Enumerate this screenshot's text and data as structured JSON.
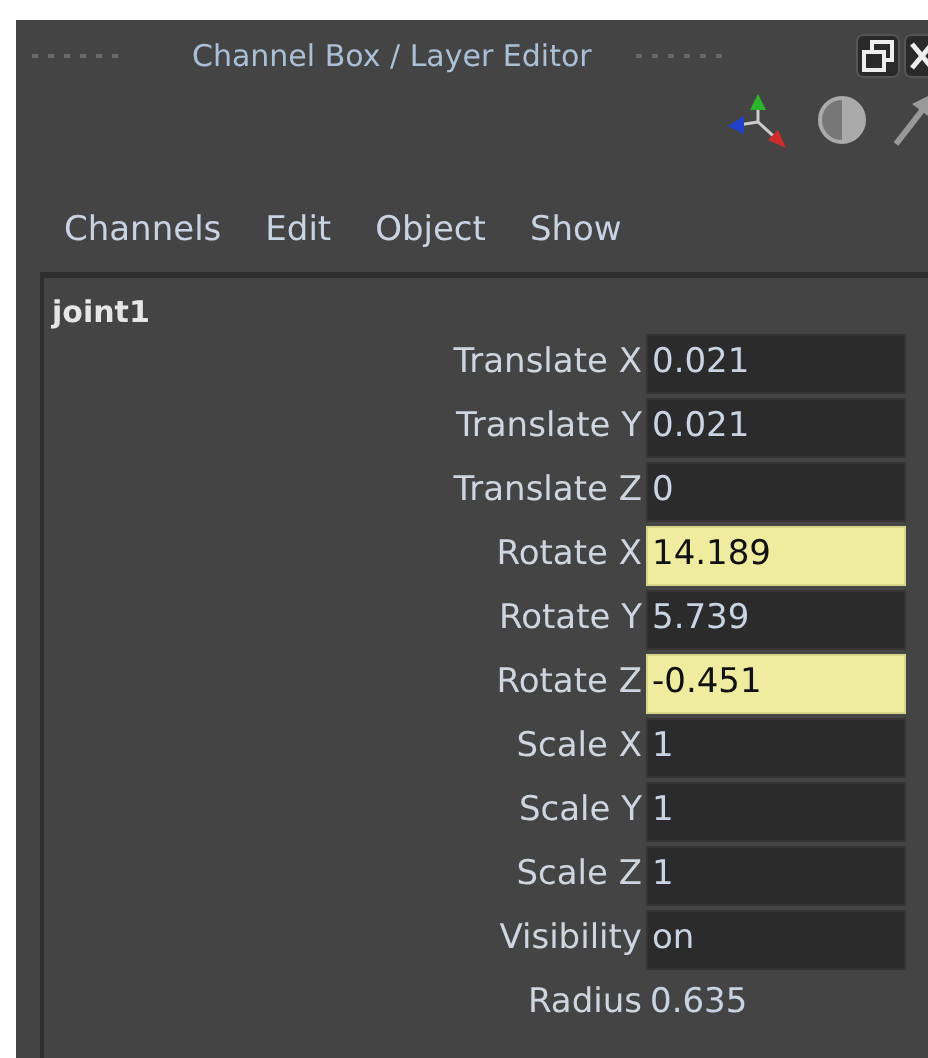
{
  "window": {
    "title": "Channel Box / Layer Editor"
  },
  "menu": [
    "Channels",
    "Edit",
    "Object",
    "Show"
  ],
  "node": {
    "name": "joint1"
  },
  "channels": [
    {
      "label": "Translate X",
      "value": "0.021",
      "kind": "field",
      "keyed": false
    },
    {
      "label": "Translate Y",
      "value": "0.021",
      "kind": "field",
      "keyed": false
    },
    {
      "label": "Translate Z",
      "value": "0",
      "kind": "field",
      "keyed": false
    },
    {
      "label": "Rotate X",
      "value": "14.189",
      "kind": "field",
      "keyed": true
    },
    {
      "label": "Rotate Y",
      "value": "5.739",
      "kind": "field",
      "keyed": false
    },
    {
      "label": "Rotate Z",
      "value": "-0.451",
      "kind": "field",
      "keyed": true
    },
    {
      "label": "Scale X",
      "value": "1",
      "kind": "field",
      "keyed": false
    },
    {
      "label": "Scale Y",
      "value": "1",
      "kind": "field",
      "keyed": false
    },
    {
      "label": "Scale Z",
      "value": "1",
      "kind": "field",
      "keyed": false
    },
    {
      "label": "Visibility",
      "value": "on",
      "kind": "field",
      "keyed": false
    },
    {
      "label": "Radius",
      "value": "0.635",
      "kind": "plain",
      "keyed": false
    }
  ]
}
